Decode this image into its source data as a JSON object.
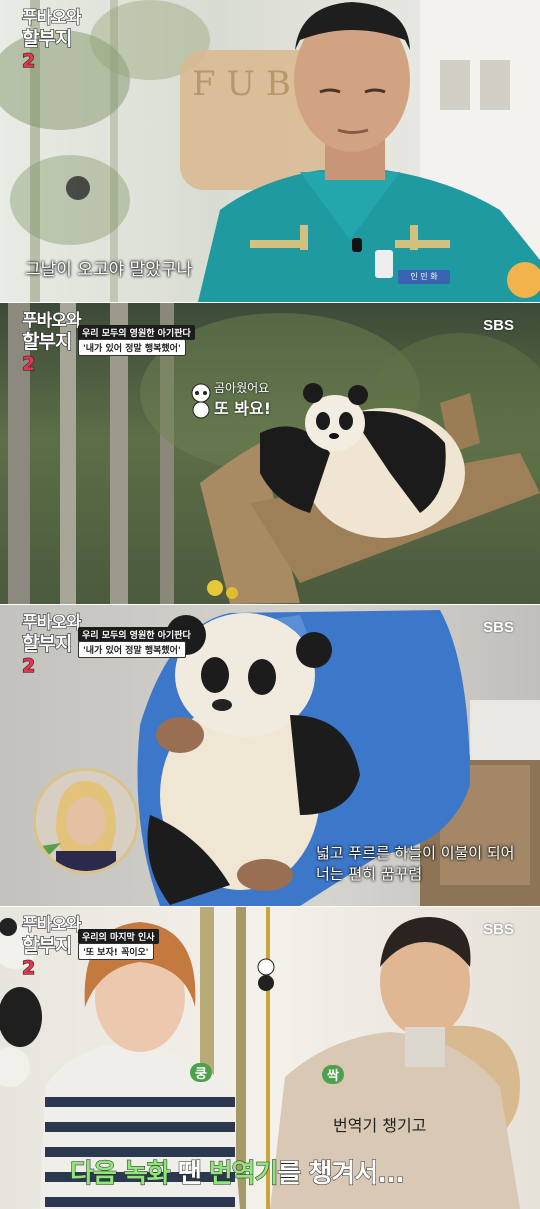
{
  "panel1": {
    "logo": {
      "line1": "푸바오와",
      "line2": "할부지",
      "num": "2"
    },
    "subtitle": "그날이 오고야 말았구나",
    "nametag": "인 민 화"
  },
  "panel2": {
    "logo": {
      "line1": "푸바오와",
      "line2": "할부지",
      "num": "2"
    },
    "banner_top": "우리 모두의 영원한 아기판다",
    "banner_bottom": "'내가 있어 정말 행복했어'",
    "broadcaster": "SBS",
    "bubble_line1": "곰아웠어요",
    "bubble_line2": "또 봐요!"
  },
  "panel3": {
    "logo": {
      "line1": "푸바오와",
      "line2": "할부지",
      "num": "2"
    },
    "banner_top": "우리 모두의 영원한 아기판다",
    "banner_bottom": "'내가 있어 정말 행복했어'",
    "broadcaster": "SBS",
    "caption_line1": "넓고 푸르른 하늘이 이불이 되어",
    "caption_line2": "너는 편히 꿈꾸렴"
  },
  "panel4": {
    "logo": {
      "line1": "푸바오와",
      "line2": "할부지",
      "num": "2"
    },
    "banner_top": "우리의 마지막 인사",
    "banner_bottom": "'또 보자! 꼭이오'",
    "broadcaster": "SBS",
    "sfx_left": "쿵",
    "sfx_right": "싹",
    "caption_upper": "번역기 챙기고",
    "caption_main_a": "다음 녹화",
    "caption_main_b": " 땐 ",
    "caption_main_c": "번역기",
    "caption_main_d": "를 챙겨서..."
  }
}
